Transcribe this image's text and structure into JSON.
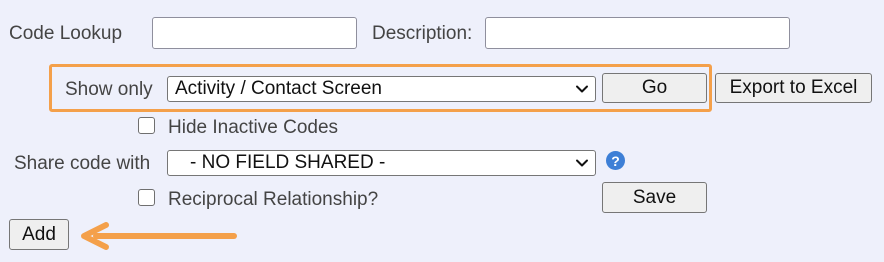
{
  "code_lookup": {
    "label": "Code Lookup",
    "value": ""
  },
  "description": {
    "label": "Description:",
    "value": ""
  },
  "show_only": {
    "label": "Show only",
    "selected": "Activity / Contact Screen"
  },
  "buttons": {
    "go": "Go",
    "export": "Export to Excel",
    "save": "Save",
    "add": "Add"
  },
  "hide_inactive": {
    "label": "Hide Inactive Codes",
    "checked": false
  },
  "share_code": {
    "label": "Share code with",
    "selected": "- NO FIELD SHARED -",
    "help_symbol": "?"
  },
  "reciprocal": {
    "label": "Reciprocal Relationship?",
    "checked": false
  },
  "colors": {
    "highlight": "#f4a04a",
    "background": "#eef0fb",
    "help_icon": "#3d7fd6"
  }
}
